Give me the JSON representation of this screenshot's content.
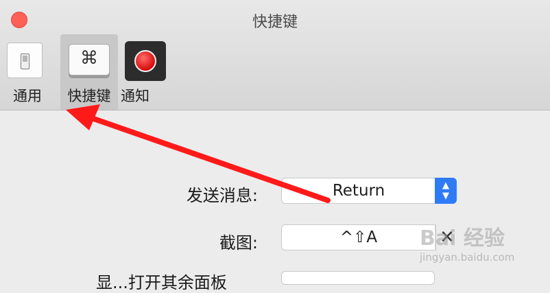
{
  "window": {
    "title": "快捷键"
  },
  "toolbar": {
    "items": [
      {
        "label": "通用",
        "icon": "toggle-switch-icon"
      },
      {
        "label": "快捷键",
        "icon": "command-key-icon",
        "glyph": "⌘"
      },
      {
        "label": "通知",
        "icon": "record-icon"
      }
    ]
  },
  "form": {
    "send_message": {
      "label": "发送消息:",
      "value": "Return"
    },
    "screenshot": {
      "label": "截图:",
      "value": "^⇧A",
      "clear_glyph": "✕"
    },
    "partial_label": "显...打开其余面板"
  },
  "watermark": {
    "brand": "Bai 经验",
    "url": "jingyan.baidu.com"
  },
  "colors": {
    "accent": "#2f7bf6",
    "close": "#fe5f57",
    "annotation_arrow": "#ff1a1a"
  }
}
